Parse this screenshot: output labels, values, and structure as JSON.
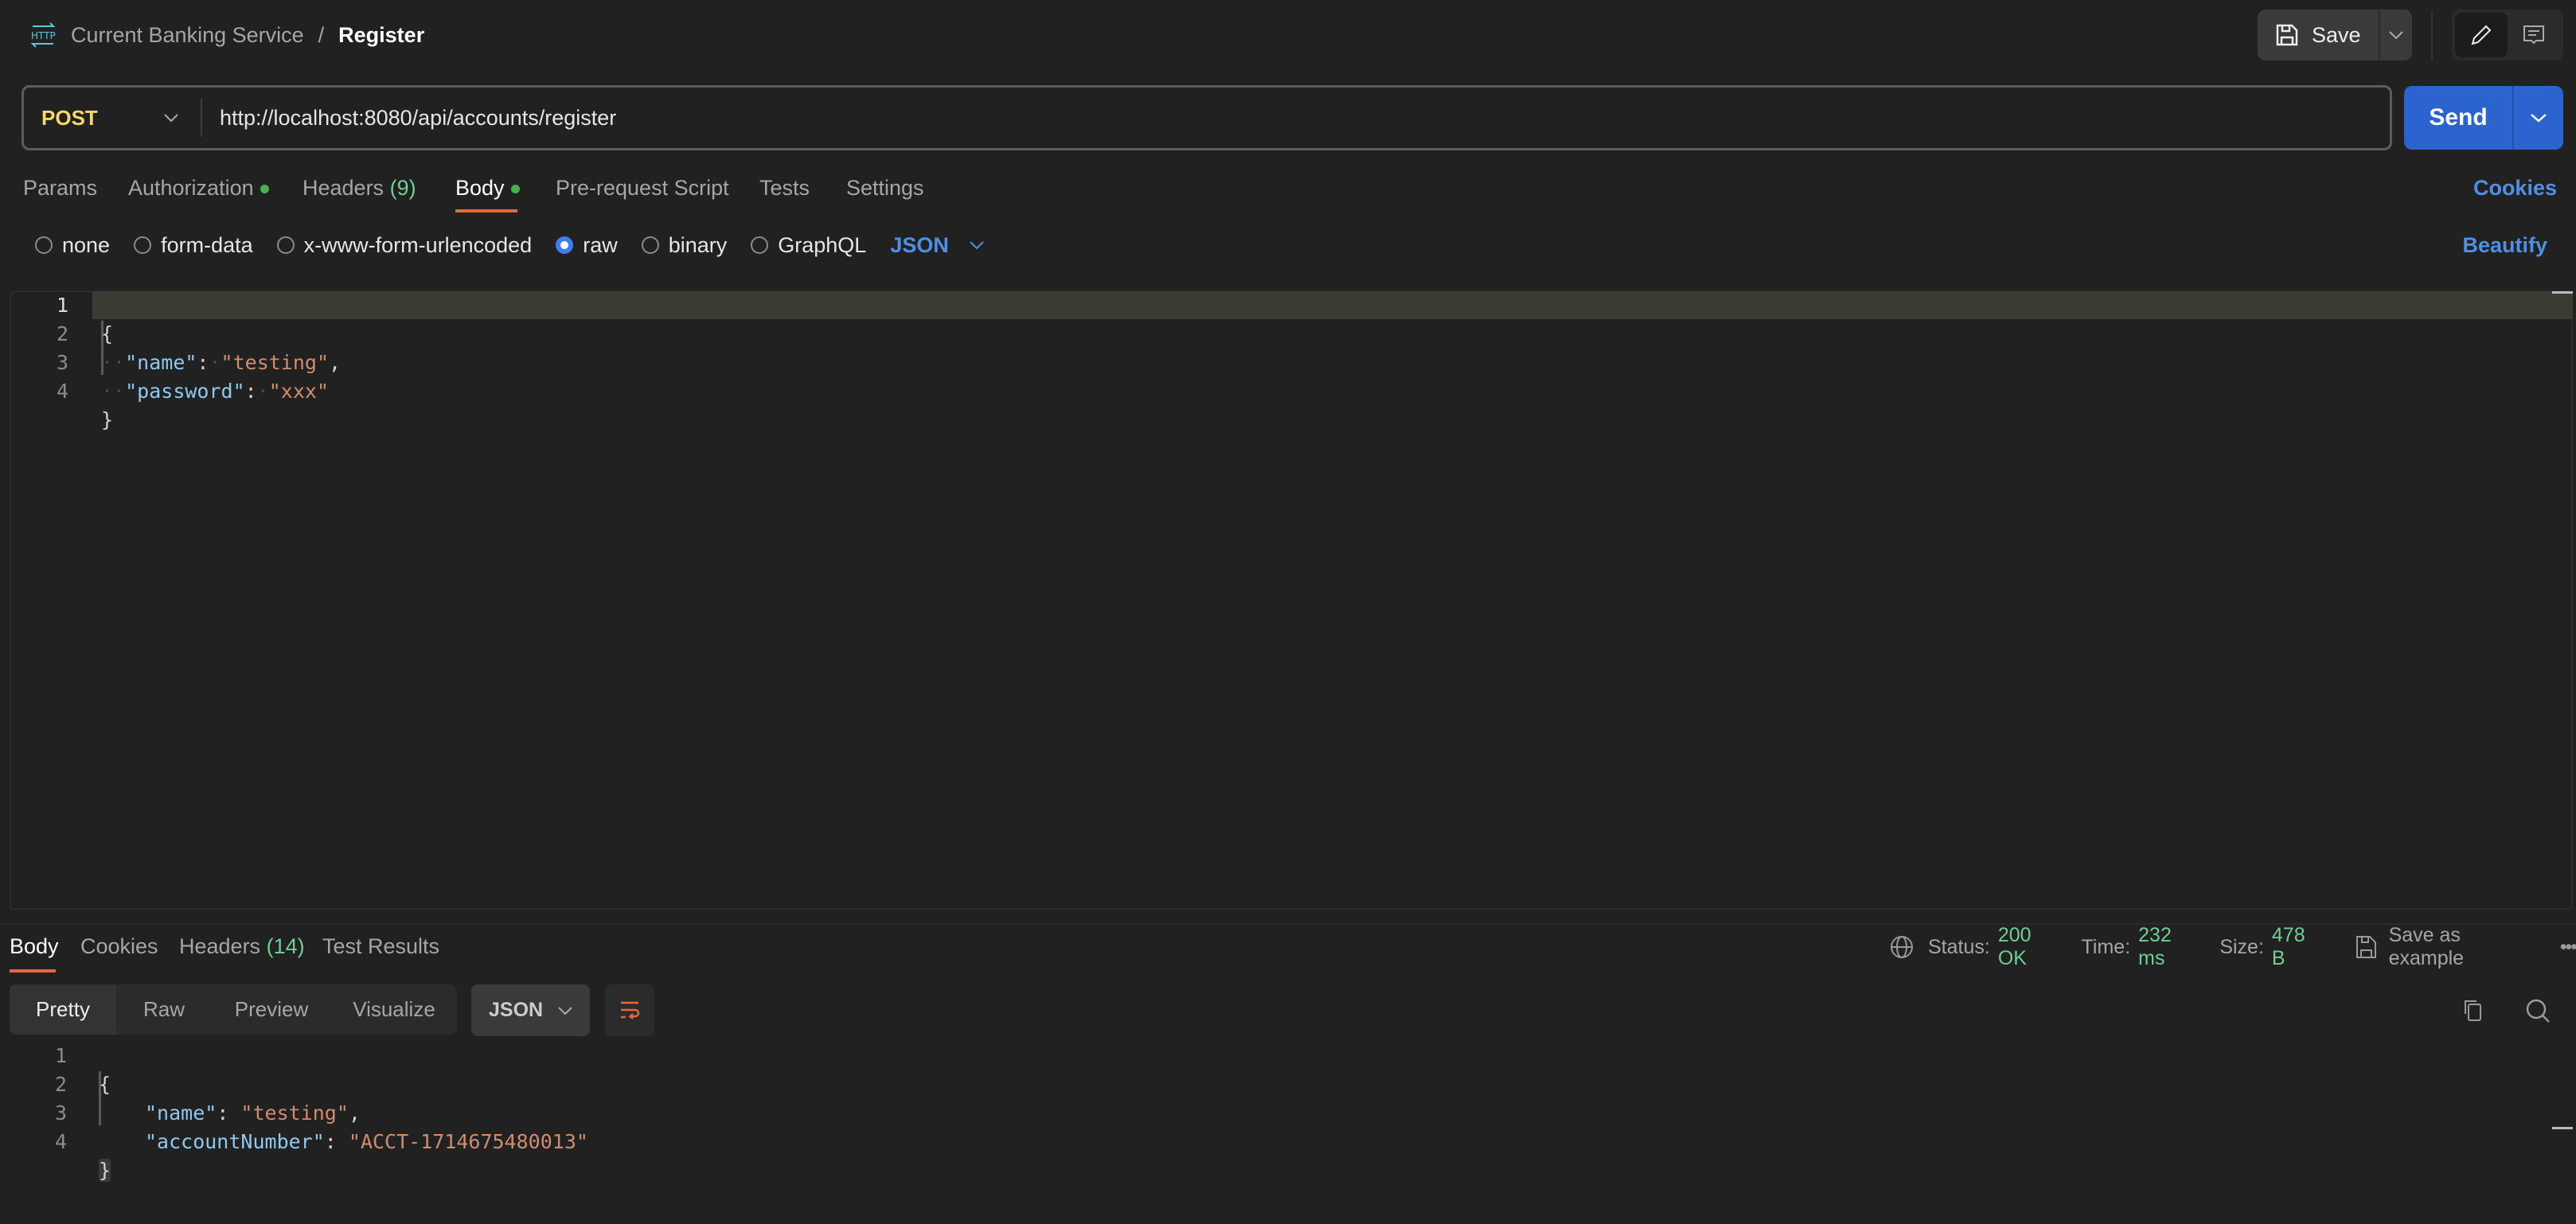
{
  "header": {
    "collection": "Current Banking Service",
    "separator": "/",
    "request_name": "Register",
    "save_label": "Save"
  },
  "request": {
    "method": "POST",
    "url": "http://localhost:8080/api/accounts/register",
    "send_label": "Send"
  },
  "tabs": [
    {
      "label": "Params"
    },
    {
      "label": "Authorization",
      "dot": true
    },
    {
      "label": "Headers",
      "count": "(9)"
    },
    {
      "label": "Body",
      "dot": true,
      "active": true
    },
    {
      "label": "Pre-request Script"
    },
    {
      "label": "Tests"
    },
    {
      "label": "Settings"
    }
  ],
  "cookies_label": "Cookies",
  "body_types": [
    {
      "label": "none"
    },
    {
      "label": "form-data"
    },
    {
      "label": "x-www-form-urlencoded"
    },
    {
      "label": "raw",
      "selected": true
    },
    {
      "label": "binary"
    },
    {
      "label": "GraphQL"
    }
  ],
  "body_format": "JSON",
  "beautify_label": "Beautify",
  "request_body": {
    "lines": [
      "1",
      "2",
      "3",
      "4"
    ],
    "open": "{",
    "close": "}",
    "key1": "\"name\"",
    "val1": "\"testing\"",
    "key2": "\"password\"",
    "val2": "\"xxx\""
  },
  "response": {
    "tabs": [
      {
        "label": "Body",
        "active": true
      },
      {
        "label": "Cookies"
      },
      {
        "label": "Headers",
        "count": "(14)"
      },
      {
        "label": "Test Results"
      }
    ],
    "status_label": "Status:",
    "status": "200 OK",
    "time_label": "Time:",
    "time": "232 ms",
    "size_label": "Size:",
    "size": "478 B",
    "save_example": "Save as example",
    "views": [
      "Pretty",
      "Raw",
      "Preview",
      "Visualize"
    ],
    "format": "JSON",
    "body": {
      "lines": [
        "1",
        "2",
        "3",
        "4"
      ],
      "open": "{",
      "close": "}",
      "key1": "\"name\"",
      "val1": "\"testing\"",
      "key2": "\"accountNumber\"",
      "val2": "\"ACCT-1714675480013\""
    }
  },
  "colors": {
    "accent": "#e8683d",
    "send": "#2b64cf",
    "success": "#6fcf97",
    "link": "#4f8fe6",
    "method": "#f5d76e"
  }
}
